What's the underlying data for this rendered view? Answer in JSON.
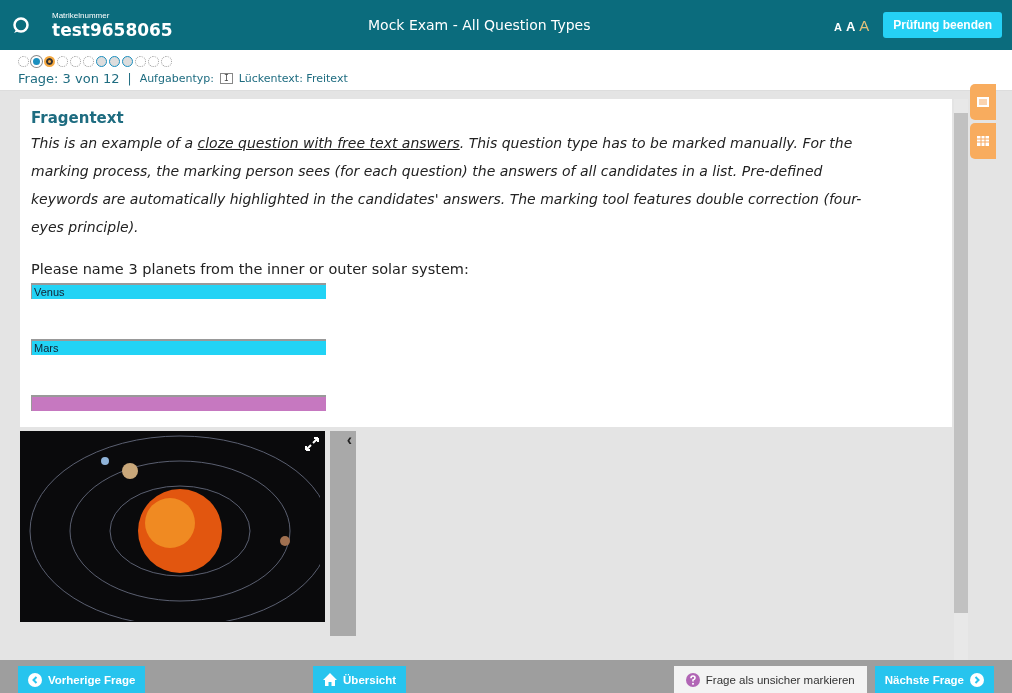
{
  "header": {
    "id_label": "Matrikelnummer",
    "id_value": "test9658065",
    "title": "Mock Exam - All Question Types",
    "font_sizes": [
      {
        "label": "A",
        "selected": false
      },
      {
        "label": "A",
        "selected": false
      },
      {
        "label": "A",
        "selected": true
      }
    ],
    "end_button": "Prüfung beenden"
  },
  "progress": [
    {
      "selected": false,
      "answered": false,
      "linked": false
    },
    {
      "selected": false,
      "answered": true,
      "linked": false
    },
    {
      "selected": true,
      "answered": false,
      "linked": false
    },
    {
      "selected": false,
      "answered": false,
      "linked": false
    },
    {
      "selected": false,
      "answered": false,
      "linked": false
    },
    {
      "selected": false,
      "answered": false,
      "linked": false
    },
    {
      "selected": false,
      "answered": false,
      "linked": true
    },
    {
      "selected": false,
      "answered": false,
      "linked": true
    },
    {
      "selected": false,
      "answered": false,
      "linked": true
    },
    {
      "selected": false,
      "answered": false,
      "linked": false
    },
    {
      "selected": false,
      "answered": false,
      "linked": false
    },
    {
      "selected": false,
      "answered": false,
      "linked": false
    }
  ],
  "info": {
    "question": "Frage: 3 von 12",
    "separator": "|",
    "type_label": "Aufgabentyp:",
    "type_icon": "I",
    "type_value": "Lückentext: Freitext"
  },
  "question": {
    "heading": "Fragentext",
    "text": [
      {
        "text": "This is an example of a ",
        "underline": false
      },
      {
        "text": "cloze question with free text answers",
        "underline": true
      },
      {
        "text": ". This question type has to be marked manually. For the marking process, the marking person sees (for each question) the answers of all candidates in a list. Pre-defined keywords are automatically highlighted in the candidates' answers. The marking tool features double correction (four-eyes principle).",
        "underline": false
      }
    ],
    "prompt": "Please name 3 planets from the inner or outer solar system:",
    "answers": [
      {
        "value": "Venus",
        "color": "#22d3f5"
      },
      {
        "value": "Mars",
        "color": "#22d3f5"
      },
      {
        "color": "#c678c0"
      }
    ],
    "collapse_handle": "‹"
  },
  "footer": {
    "previous": "Vorherige Frage",
    "overview": "Übersicht",
    "flag": "Frage als unsicher markieren",
    "next": "Nächste Frage"
  }
}
